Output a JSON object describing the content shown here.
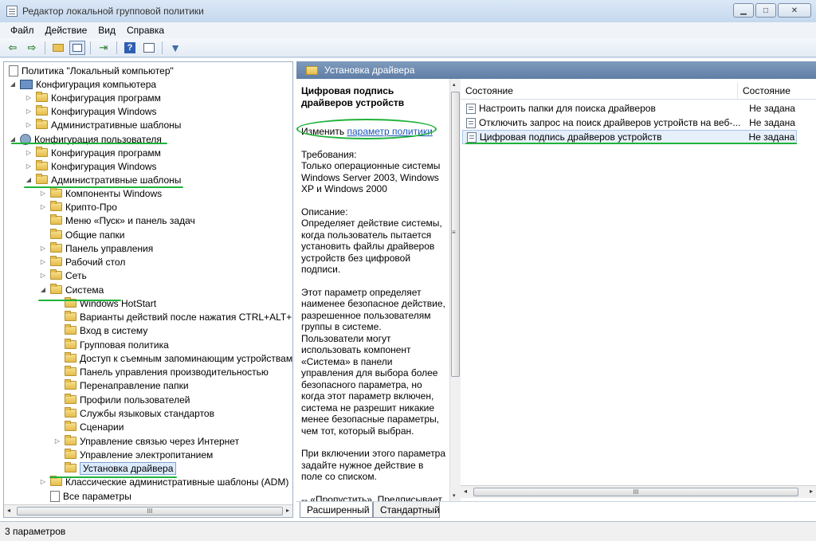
{
  "window": {
    "title": "Редактор локальной групповой политики",
    "min_glyph": "▁",
    "max_glyph": "□",
    "close_glyph": "✕"
  },
  "menu": [
    "Файл",
    "Действие",
    "Вид",
    "Справка"
  ],
  "toolbar": {
    "back_glyph": "⇦",
    "forward_glyph": "⇨",
    "export_glyph": "⇥",
    "help_glyph": "?",
    "filter_glyph": "▼"
  },
  "tree": {
    "root": "Политика \"Локальный компьютер\"",
    "computer_config": "Конфигурация компьютера",
    "cc_programs": "Конфигурация программ",
    "cc_windows": "Конфигурация Windows",
    "cc_admin": "Административные шаблоны",
    "user_config": "Конфигурация пользователя",
    "uc_programs": "Конфигурация программ",
    "uc_windows": "Конфигурация Windows",
    "uc_admin": "Административные шаблоны",
    "windows_components": "Компоненты Windows",
    "crypto_pro": "Крипто-Про",
    "start_menu": "Меню «Пуск» и панель задач",
    "shared_folders": "Общие папки",
    "control_panel": "Панель управления",
    "desktop": "Рабочий стол",
    "network": "Сеть",
    "system": "Система",
    "hotstart": "Windows HotStart",
    "ctrl_alt_del": "Варианты действий после нажатия CTRL+ALT+DE",
    "logon": "Вход в систему",
    "group_policy": "Групповая политика",
    "removable": "Доступ к съемным запоминающим устройствам",
    "perf_panel": "Панель управления производительностью",
    "redirect": "Перенаправление папки",
    "profiles": "Профили пользователей",
    "locale": "Службы языковых стандартов",
    "scripts": "Сценарии",
    "internet_comm": "Управление связью через Интернет",
    "power": "Управление электропитанием",
    "driver_install": "Установка драйвера",
    "classic_admin": "Классические административные шаблоны (ADM)",
    "all_settings": "Все параметры",
    "expanded_glyph": "◢",
    "collapsed_glyph": "▷"
  },
  "desc": {
    "header": "Установка драйвера",
    "policy_title": "Цифровая подпись драйверов устройств",
    "edit_prefix": "Изменить ",
    "edit_link": "параметр политики",
    "requirements": "Требования:\nТолько операционные системы Windows Server 2003, Windows XP и Windows 2000",
    "description": "Описание:\nОпределяет действие системы, когда пользователь пытается установить файлы драйверов устройств без цифровой подписи.",
    "body1": "Этот параметр определяет наименее безопасное действие, разрешенное пользователям группы в системе. Пользователи могут использовать компонент «Система» в панели управления для выбора более безопасного параметра, но когда этот параметр включен, система не разрешит никакие менее безопасные параметры, чем тот, который выбран.",
    "body2": "При включении этого параметра задайте нужное действие в поле со списком.",
    "body3": "--    «Пропустить». Предписывает системе продолжить установку"
  },
  "list": {
    "col_name": "Состояние",
    "col_state": "Состояние",
    "rows": [
      {
        "name": "Настроить папки для поиска драйверов",
        "state": "Не задана"
      },
      {
        "name": "Отключить запрос на поиск драйверов устройств на веб-...",
        "state": "Не задана"
      },
      {
        "name": "Цифровая подпись драйверов устройств",
        "state": "Не задана"
      }
    ]
  },
  "scroll": {
    "grip_h": "III",
    "grip_v": "≡",
    "left": "◂",
    "right": "▸",
    "up": "▴",
    "down": "▾"
  },
  "tabs": [
    "Расширенный",
    "Стандартный"
  ],
  "status": "3 параметров"
}
